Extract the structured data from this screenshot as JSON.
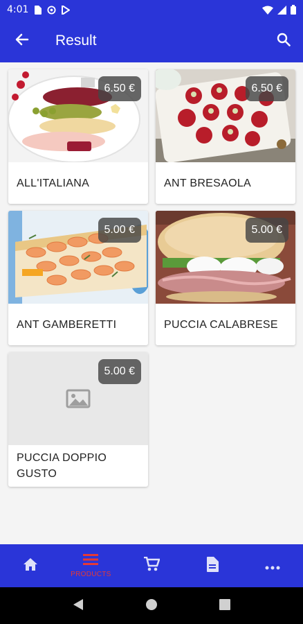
{
  "status_bar": {
    "time": "4:01",
    "left_icons": [
      "sim-card-icon",
      "at-icon",
      "play-store-icon"
    ],
    "right_icons": [
      "wifi-icon",
      "signal-icon",
      "battery-icon"
    ]
  },
  "app_bar": {
    "title": "Result",
    "back_icon": "arrow-back-icon",
    "search_icon": "search-icon"
  },
  "products": [
    {
      "name": "ALL'ITALIANA",
      "price": "6.50 €",
      "image": "antipasto-platter"
    },
    {
      "name": "ANT BRESAOLA",
      "price": "6.50 €",
      "image": "bresaola-rolls"
    },
    {
      "name": "ANT GAMBERETTI",
      "price": "5.00 €",
      "image": "shrimp-tart"
    },
    {
      "name": "PUCCIA CALABRESE",
      "price": "5.00 €",
      "image": "puccia-sandwich"
    },
    {
      "name": "PUCCIA DOPPIO GUSTO",
      "price": "5.00 €",
      "image": "placeholder-image-icon"
    }
  ],
  "bottom_nav": {
    "items": [
      {
        "icon": "home-icon",
        "label": "",
        "active": false
      },
      {
        "icon": "menu-list-icon",
        "label": "PRODUCTS",
        "active": true
      },
      {
        "icon": "cart-icon",
        "label": "",
        "active": false
      },
      {
        "icon": "document-icon",
        "label": "",
        "active": false
      },
      {
        "icon": "more-icon",
        "label": "",
        "active": false
      }
    ]
  },
  "colors": {
    "primary": "#2a35d8",
    "active_nav": "#e53935",
    "background": "#f4f4f4",
    "price_badge": "#464646"
  }
}
